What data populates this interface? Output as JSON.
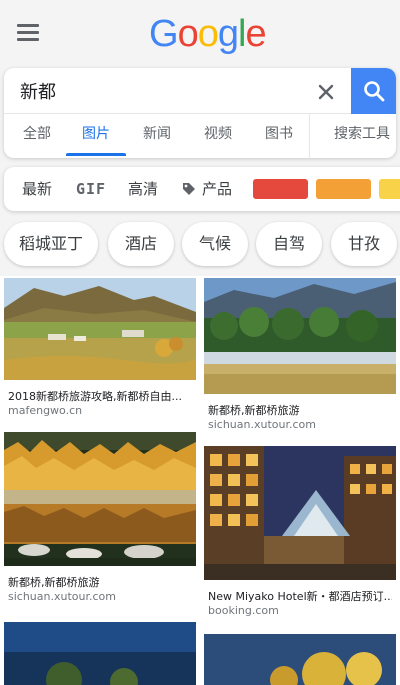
{
  "header": {
    "logo_letters": [
      {
        "ch": "G",
        "color": "#4285f4"
      },
      {
        "ch": "o",
        "color": "#ea4335"
      },
      {
        "ch": "o",
        "color": "#fbbc05"
      },
      {
        "ch": "g",
        "color": "#4285f4"
      },
      {
        "ch": "l",
        "color": "#34a853"
      },
      {
        "ch": "e",
        "color": "#ea4335"
      }
    ]
  },
  "search": {
    "query": "新都"
  },
  "tabs": [
    "全部",
    "图片",
    "新闻",
    "视频",
    "图书",
    "搜索工具"
  ],
  "active_tab": "图片",
  "filters": {
    "latest": "最新",
    "gif": "GIF",
    "hd": "高清",
    "product": "产品",
    "colors": [
      "#e5483c",
      "#f3a036",
      "#f8d34a"
    ]
  },
  "chips": [
    "稻城亚丁",
    "酒店",
    "气候",
    "自驾",
    "甘孜"
  ],
  "results": {
    "left": [
      {
        "title": "2018新都桥旅游攻略,新都桥自由...",
        "source": "mafengwo.cn"
      },
      {
        "title": "新都桥,新都桥旅游",
        "source": "sichuan.xutour.com"
      }
    ],
    "right": [
      {
        "title": "新都桥,新都桥旅游",
        "source": "sichuan.xutour.com"
      },
      {
        "title": "New Miyako Hotel新・都酒店预订...",
        "source": "booking.com"
      }
    ]
  }
}
